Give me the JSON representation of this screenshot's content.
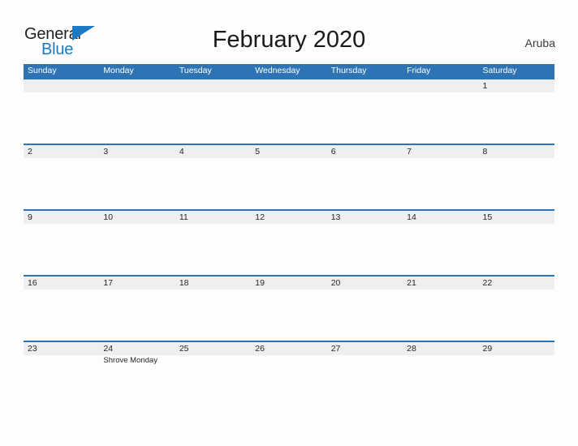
{
  "brand": {
    "name_part1": "General",
    "name_part2": "Blue",
    "flag_icon": "blue-triangle-flag-icon",
    "accent_color": "#1a7bc4"
  },
  "header": {
    "title": "February 2020",
    "region": "Aruba"
  },
  "calendar": {
    "header_color": "#2e74b5",
    "number_band_color": "#efeff0",
    "weekdays": [
      "Sunday",
      "Monday",
      "Tuesday",
      "Wednesday",
      "Thursday",
      "Friday",
      "Saturday"
    ],
    "weeks": [
      [
        {
          "day": "",
          "event": ""
        },
        {
          "day": "",
          "event": ""
        },
        {
          "day": "",
          "event": ""
        },
        {
          "day": "",
          "event": ""
        },
        {
          "day": "",
          "event": ""
        },
        {
          "day": "",
          "event": ""
        },
        {
          "day": "1",
          "event": ""
        }
      ],
      [
        {
          "day": "2",
          "event": ""
        },
        {
          "day": "3",
          "event": ""
        },
        {
          "day": "4",
          "event": ""
        },
        {
          "day": "5",
          "event": ""
        },
        {
          "day": "6",
          "event": ""
        },
        {
          "day": "7",
          "event": ""
        },
        {
          "day": "8",
          "event": ""
        }
      ],
      [
        {
          "day": "9",
          "event": ""
        },
        {
          "day": "10",
          "event": ""
        },
        {
          "day": "11",
          "event": ""
        },
        {
          "day": "12",
          "event": ""
        },
        {
          "day": "13",
          "event": ""
        },
        {
          "day": "14",
          "event": ""
        },
        {
          "day": "15",
          "event": ""
        }
      ],
      [
        {
          "day": "16",
          "event": ""
        },
        {
          "day": "17",
          "event": ""
        },
        {
          "day": "18",
          "event": ""
        },
        {
          "day": "19",
          "event": ""
        },
        {
          "day": "20",
          "event": ""
        },
        {
          "day": "21",
          "event": ""
        },
        {
          "day": "22",
          "event": ""
        }
      ],
      [
        {
          "day": "23",
          "event": ""
        },
        {
          "day": "24",
          "event": "Shrove Monday"
        },
        {
          "day": "25",
          "event": ""
        },
        {
          "day": "26",
          "event": ""
        },
        {
          "day": "27",
          "event": ""
        },
        {
          "day": "28",
          "event": ""
        },
        {
          "day": "29",
          "event": ""
        }
      ]
    ]
  }
}
